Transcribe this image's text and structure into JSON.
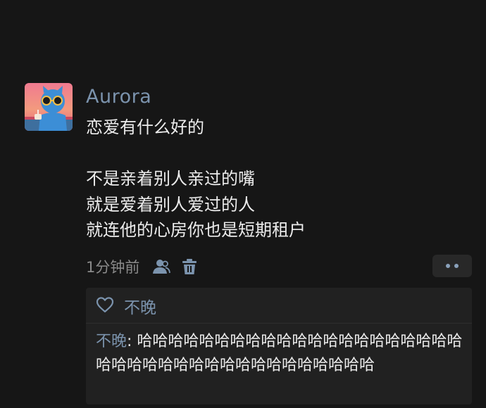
{
  "post": {
    "author": "Aurora",
    "lines": [
      "恋爱有什么好的",
      "",
      "不是亲着别人亲过的嘴",
      "就是爱着别人爱过的人",
      "就连他的心房你也是短期租户"
    ],
    "timestamp": "1分钟前",
    "icons": {
      "avatar": "avatar-cartoon-cat-sunglasses",
      "visibility": "friends-icon",
      "delete": "trash-icon",
      "more": "more-dots-icon"
    }
  },
  "interactions": {
    "likes": {
      "icon": "heart-icon",
      "names": "不晚"
    },
    "comments": [
      {
        "author": "不晚",
        "separator": ": ",
        "text": "哈哈哈哈哈哈哈哈哈哈哈哈哈哈哈哈哈哈哈哈哈哈哈哈哈哈哈哈哈哈哈哈哈哈哈哈哈哈哈"
      }
    ]
  },
  "colors": {
    "background": "#161616",
    "link": "#7b93ad",
    "text": "#ececec",
    "muted": "#8a8a8a",
    "panel": "#212121"
  }
}
